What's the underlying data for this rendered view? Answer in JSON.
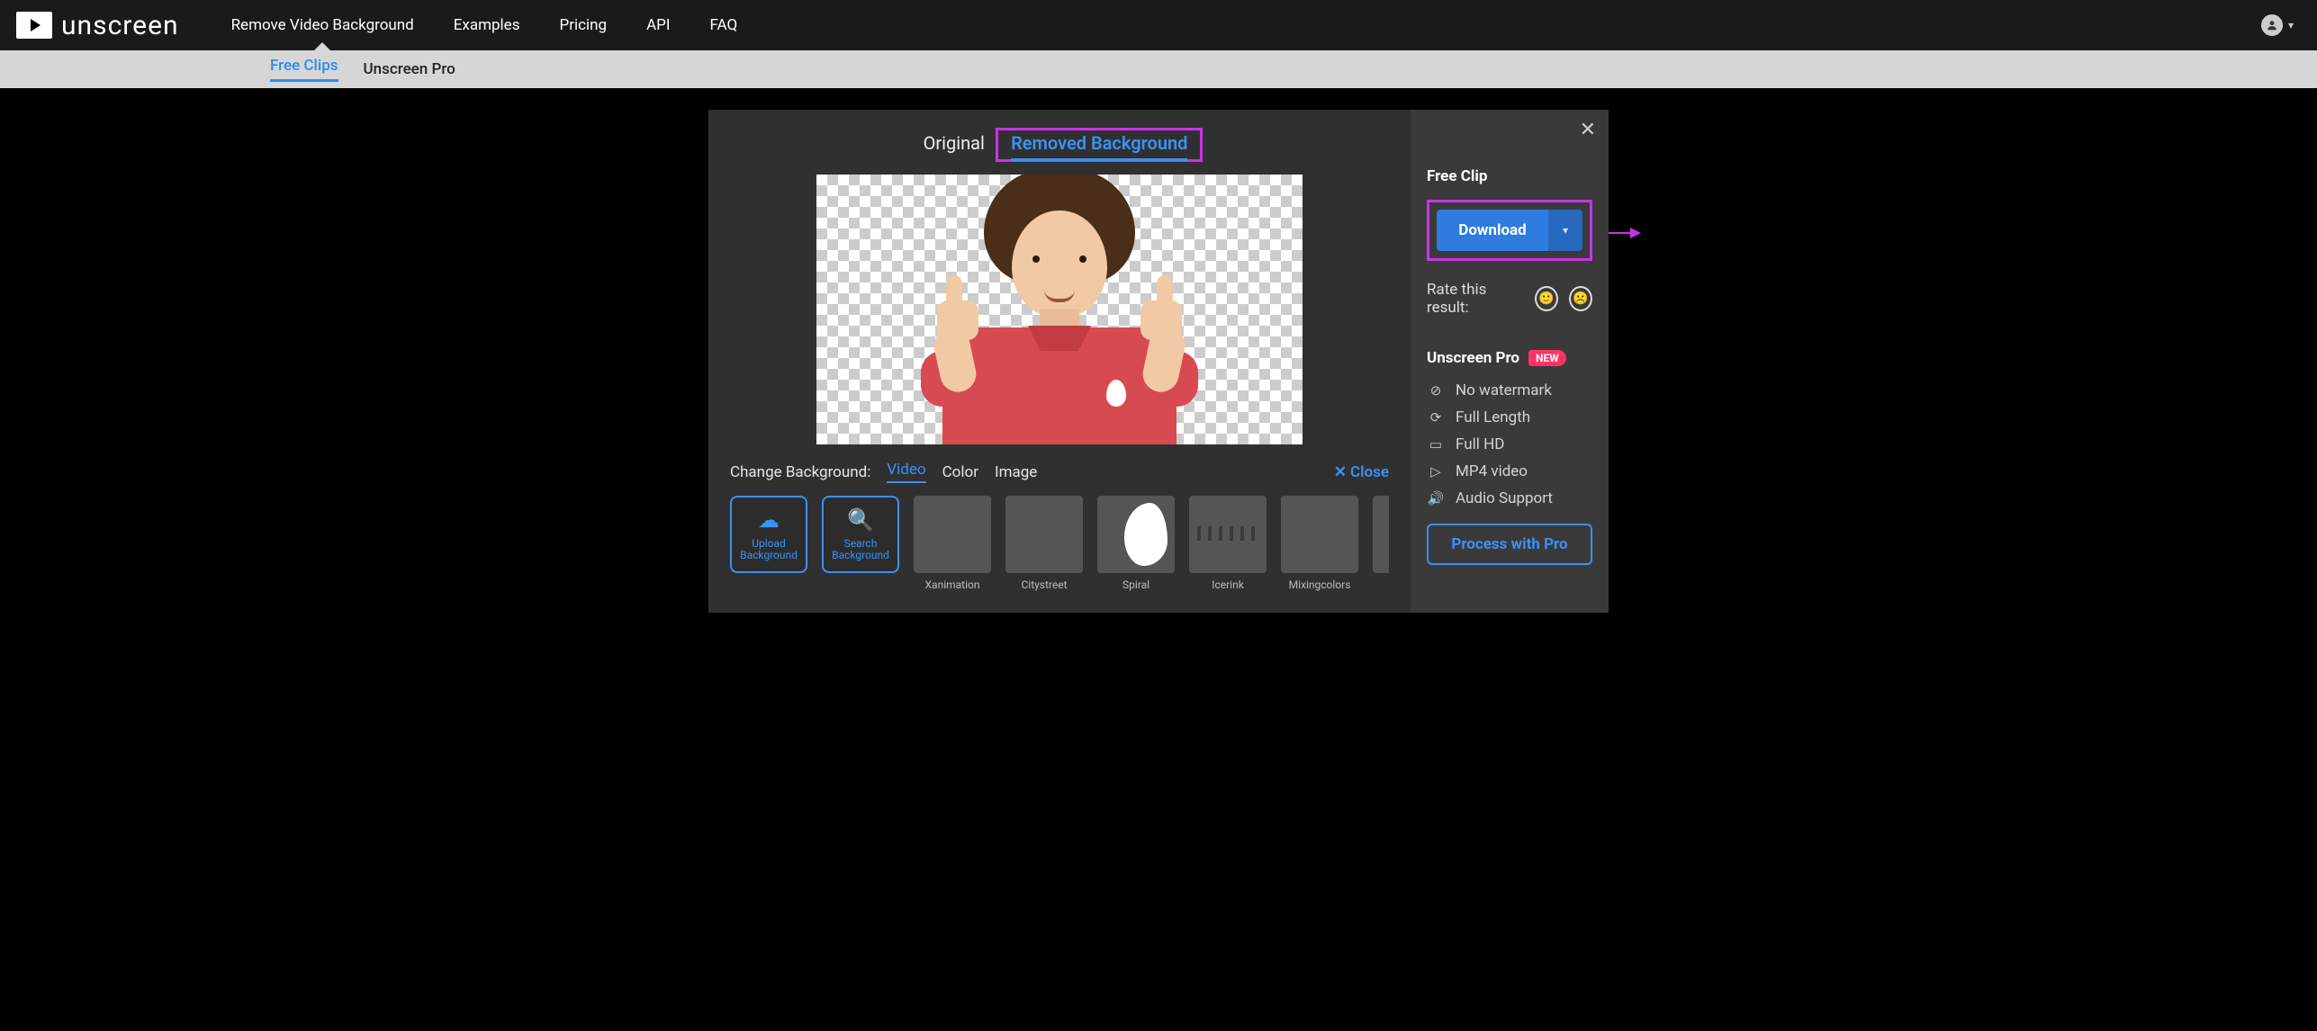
{
  "brand": "unscreen",
  "nav": {
    "items": [
      {
        "label": "Remove Video Background",
        "active": true
      },
      {
        "label": "Examples"
      },
      {
        "label": "Pricing"
      },
      {
        "label": "API"
      },
      {
        "label": "FAQ"
      }
    ]
  },
  "subnav": {
    "items": [
      {
        "label": "Free Clips",
        "active": true
      },
      {
        "label": "Unscreen Pro"
      }
    ]
  },
  "editor": {
    "tabs": [
      {
        "label": "Original"
      },
      {
        "label": "Removed Background",
        "active": true
      }
    ],
    "bg_panel": {
      "label": "Change Background:",
      "modes": [
        {
          "label": "Video",
          "active": true
        },
        {
          "label": "Color"
        },
        {
          "label": "Image"
        }
      ],
      "close": "Close",
      "tools": [
        {
          "label": "Upload Background"
        },
        {
          "label": "Search Background"
        }
      ],
      "presets": [
        {
          "label": "Xanimation"
        },
        {
          "label": "Citystreet"
        },
        {
          "label": "Spiral"
        },
        {
          "label": "Icerink"
        },
        {
          "label": "Mixingcolors"
        }
      ]
    }
  },
  "sidebar": {
    "title": "Free Clip",
    "download": "Download",
    "rate_label": "Rate this result:",
    "pro_title": "Unscreen Pro",
    "new_badge": "NEW",
    "features": [
      "No watermark",
      "Full Length",
      "Full HD",
      "MP4 video",
      "Audio Support"
    ],
    "pro_button": "Process with Pro"
  }
}
